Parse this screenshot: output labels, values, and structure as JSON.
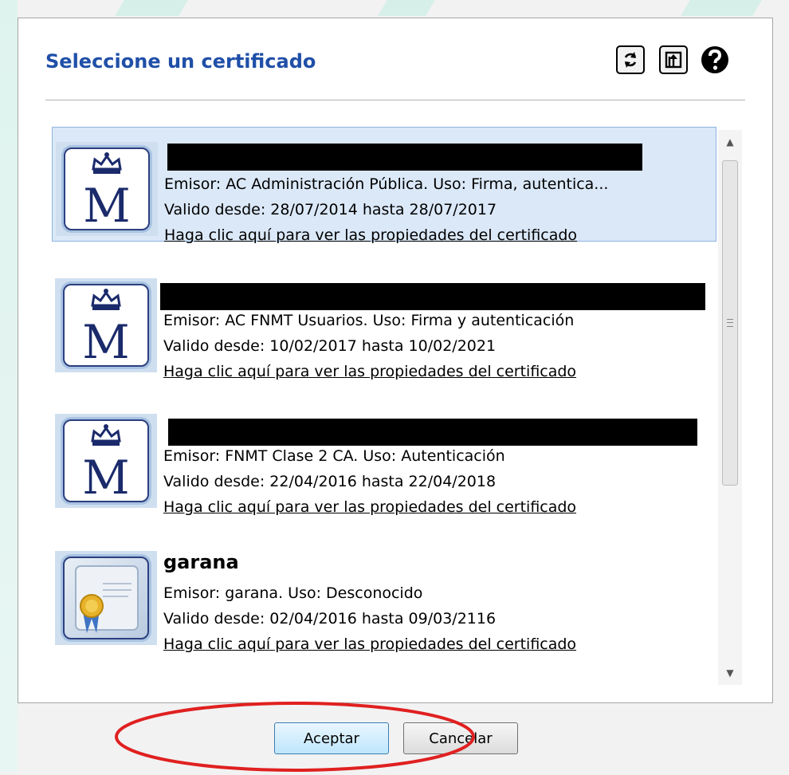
{
  "dialog": {
    "title": "Seleccione un certificado",
    "toolbar": {
      "refresh_icon": "refresh-icon",
      "export_icon": "export-icon",
      "help_icon": "help-icon"
    }
  },
  "certificates": [
    {
      "name": "",
      "name_redacted": true,
      "selected": true,
      "icon": "royal-crown-m-icon",
      "issuer_usage": "Emisor: AC Administración Pública. Uso: Firma, autentica...",
      "validity": "Valido desde: 28/07/2014 hasta 28/07/2017",
      "link": "Haga clic aquí para ver las propiedades del certificado"
    },
    {
      "name": "",
      "name_redacted": true,
      "selected": false,
      "icon": "royal-crown-m-icon",
      "issuer_usage": "Emisor: AC FNMT Usuarios. Uso: Firma y autenticación",
      "validity": "Valido desde: 10/02/2017 hasta 10/02/2021",
      "link": "Haga clic aquí para ver las propiedades del certificado"
    },
    {
      "name": "",
      "name_redacted": true,
      "selected": false,
      "icon": "royal-crown-m-icon",
      "issuer_usage": "Emisor: FNMT Clase 2 CA. Uso: Autenticación",
      "validity": "Valido desde: 22/04/2016 hasta 22/04/2018",
      "link": "Haga clic aquí para ver las propiedades del certificado"
    },
    {
      "name": "garana",
      "name_redacted": false,
      "selected": false,
      "icon": "certificate-seal-icon",
      "issuer_usage": "Emisor: garana. Uso: Desconocido",
      "validity": "Valido desde: 02/04/2016 hasta 09/03/2116",
      "link": "Haga clic aquí para ver las propiedades del certificado"
    }
  ],
  "buttons": {
    "accept": "Aceptar",
    "cancel": "Cancelar"
  },
  "colors": {
    "title": "#1f4fa8",
    "selection": "#dbe8f8",
    "annotation": "#e02020"
  }
}
